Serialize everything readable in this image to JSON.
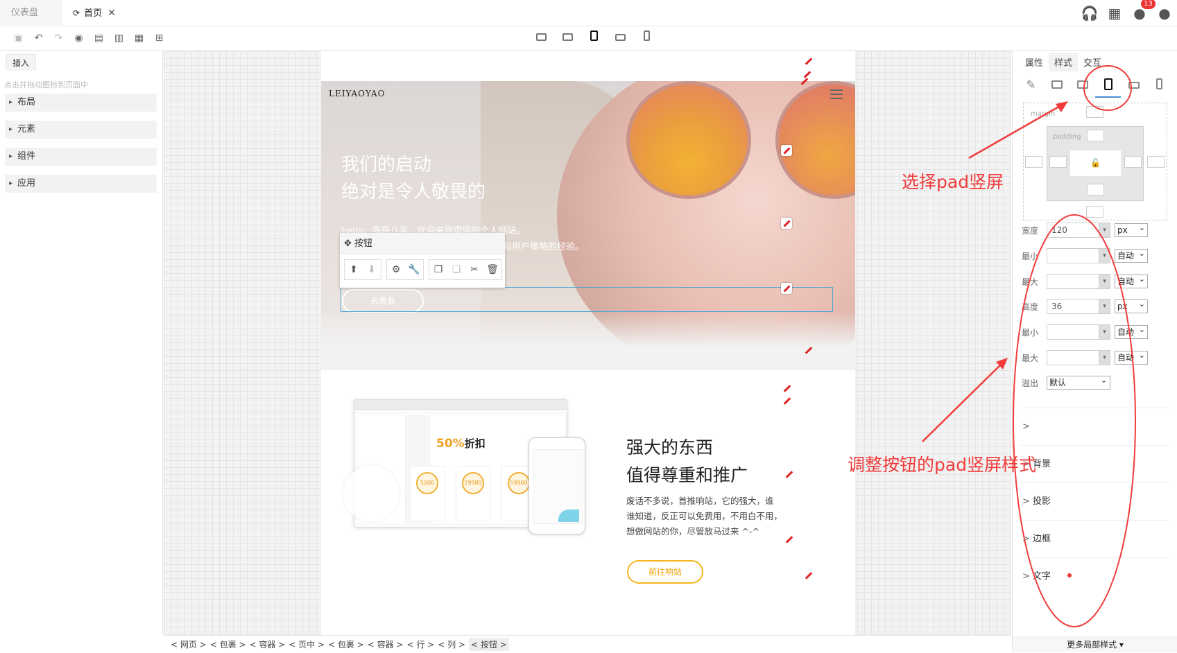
{
  "tabs": [
    {
      "label": "仪表盘"
    },
    {
      "label": "首页"
    }
  ],
  "topbar": {
    "badge_count": "13"
  },
  "left_panel": {
    "tab": "插入",
    "hint": "点击并拖动图标到页面中",
    "items": [
      {
        "label": "布局"
      },
      {
        "label": "元素"
      },
      {
        "label": "组件"
      },
      {
        "label": "应用"
      }
    ]
  },
  "hero": {
    "brand": "LEIYAOYAO",
    "title_line1": "我们的启动",
    "title_line2": "绝对是令人敬畏的",
    "subtitle_line1": "hello，我是八呆，欢迎来到雷瑶的个人网站。",
    "subtitle_line2": "和用户策略的经验。",
    "button": "去看看"
  },
  "popup": {
    "title": "按钮"
  },
  "section2": {
    "title_line1": "强大的东西",
    "title_line2": "值得尊重和推广",
    "text_line1": "废话不多说，首推响站，它的强大，谁",
    "text_line2": "谁知道，反正可以免费用，不用白不用，",
    "text_line3": "想做网站的你，尽管放马过来 ^-^",
    "button": "前往响站",
    "mock": {
      "discount": "50%",
      "discount_word": "折扣",
      "card1": "5000",
      "card2": "19980",
      "card3": "59960"
    }
  },
  "breadcrumb": [
    {
      "label": "< 网页 >"
    },
    {
      "label": "< 包裹 >"
    },
    {
      "label": "< 容器 >"
    },
    {
      "label": "< 页中 >"
    },
    {
      "label": "< 包裹 >"
    },
    {
      "label": "< 容器 >"
    },
    {
      "label": "< 行 >"
    },
    {
      "label": "< 列 >"
    },
    {
      "label": "< 按钮 >"
    }
  ],
  "right_panel": {
    "tabs": [
      {
        "label": "属性"
      },
      {
        "label": "样式"
      },
      {
        "label": "交互"
      }
    ],
    "margin_label": "margin",
    "padding_label": "padding",
    "rows": [
      {
        "label": "宽度",
        "value": "120",
        "unit": "px"
      },
      {
        "label": "最小",
        "value": "",
        "unit": "自动"
      },
      {
        "label": "最大",
        "value": "",
        "unit": "自动"
      },
      {
        "label": "高度",
        "value": "36",
        "unit": "px"
      },
      {
        "label": "最小",
        "value": "",
        "unit": "自动"
      },
      {
        "label": "最大",
        "value": "",
        "unit": "自动"
      }
    ],
    "overflow_label": "溢出",
    "overflow_value": "默认",
    "sections": [
      {
        "label": "背景"
      },
      {
        "label": "投影"
      },
      {
        "label": "边框"
      },
      {
        "label": "文字"
      }
    ],
    "more": "更多局部样式 ▾"
  },
  "annotations": {
    "select_pad": "选择pad竖屏",
    "adjust_button": "调整按钮的pad竖屏样式"
  },
  "colors": {
    "annotation": "#f23b3b",
    "accent": "#f3b51e",
    "selection": "#4aa6d8"
  }
}
